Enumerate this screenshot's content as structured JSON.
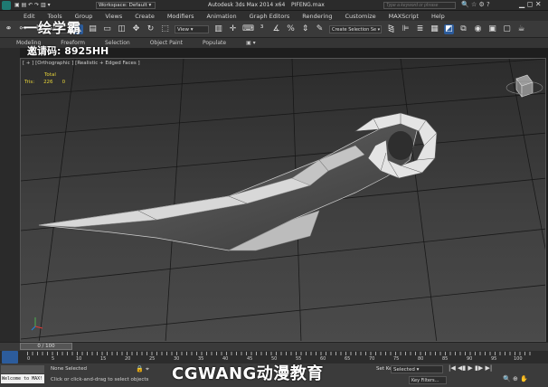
{
  "title": {
    "workspace": "Workspace: Default",
    "app": "Autodesk 3ds Max  2014 x64",
    "file": "PIFENG.max",
    "search_placeholder": "Type a keyword or phrase"
  },
  "menu": [
    "Edit",
    "Tools",
    "Group",
    "Views",
    "Create",
    "Modifiers",
    "Animation",
    "Graph Editors",
    "Rendering",
    "Customize",
    "MAXScript",
    "Help"
  ],
  "toolbar": {
    "view_value": "View",
    "selection_set_placeholder": "Create Selection Se"
  },
  "ribbon": {
    "tabs": [
      "Modeling",
      "Freeform",
      "Selection",
      "Object Paint",
      "Populate"
    ]
  },
  "watermark": {
    "brand": "一绘学霸",
    "invite": "邀请码: 8925HH"
  },
  "viewport": {
    "label": "[ + ] [Orthographic ] [Realistic + Edged Faces ]",
    "stats_total": "Total",
    "stats_tris_label": "Tris:",
    "stats_tris_value": "226",
    "stats_tris_value2": "0"
  },
  "timeline": {
    "slider_text": "0 / 100",
    "ticks": [
      "0",
      "5",
      "10",
      "15",
      "20",
      "25",
      "30",
      "35",
      "40",
      "45",
      "50",
      "55",
      "60",
      "65",
      "70",
      "75",
      "80",
      "85",
      "90",
      "95",
      "100"
    ]
  },
  "status": {
    "selected": "None Selected",
    "hint": "Click or click-and-drag to select objects",
    "welcome": "Welcome to MAX!",
    "key_mode": "Selected",
    "key_label": "Set Key",
    "key_filters": "Key Filters..."
  },
  "overlay_logo": "CGWANG动漫教育",
  "colors": {
    "bg": "#1e1e1e",
    "mesh": "#dcdcdc",
    "stats": "#e6d33a",
    "accent_blue": "#2c5c9c"
  }
}
